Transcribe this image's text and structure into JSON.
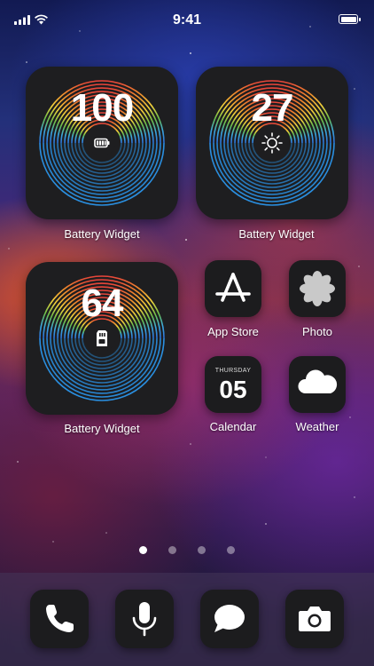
{
  "status_bar": {
    "time": "9:41"
  },
  "widgets": [
    {
      "value": "100",
      "label": "Battery Widget",
      "icon": "battery-full-icon"
    },
    {
      "value": "27",
      "label": "Battery Widget",
      "icon": "brightness-sun-icon"
    },
    {
      "value": "64",
      "label": "Battery Widget",
      "icon": "sd-card-icon"
    }
  ],
  "apps": {
    "app_store": {
      "label": "App Store",
      "icon": "app-store-icon"
    },
    "photo": {
      "label": "Photo",
      "icon": "photo-flower-icon"
    },
    "calendar": {
      "label": "Calendar",
      "day": "THURSDAY",
      "date": "05"
    },
    "weather": {
      "label": "Weather",
      "icon": "cloud-icon"
    }
  },
  "page_dots": {
    "count": 4,
    "active": 0
  },
  "dock": [
    {
      "icon": "phone-icon"
    },
    {
      "icon": "microphone-icon"
    },
    {
      "icon": "message-bubble-icon"
    },
    {
      "icon": "camera-icon"
    }
  ],
  "colors": {
    "ring_rainbow": [
      "#e8433a",
      "#f08a2c",
      "#f3d23b",
      "#6cc04a",
      "#3aa7e0",
      "#2d6fd6"
    ],
    "ring_blue": "#2a8fe0",
    "tile": "#1e1e20"
  }
}
